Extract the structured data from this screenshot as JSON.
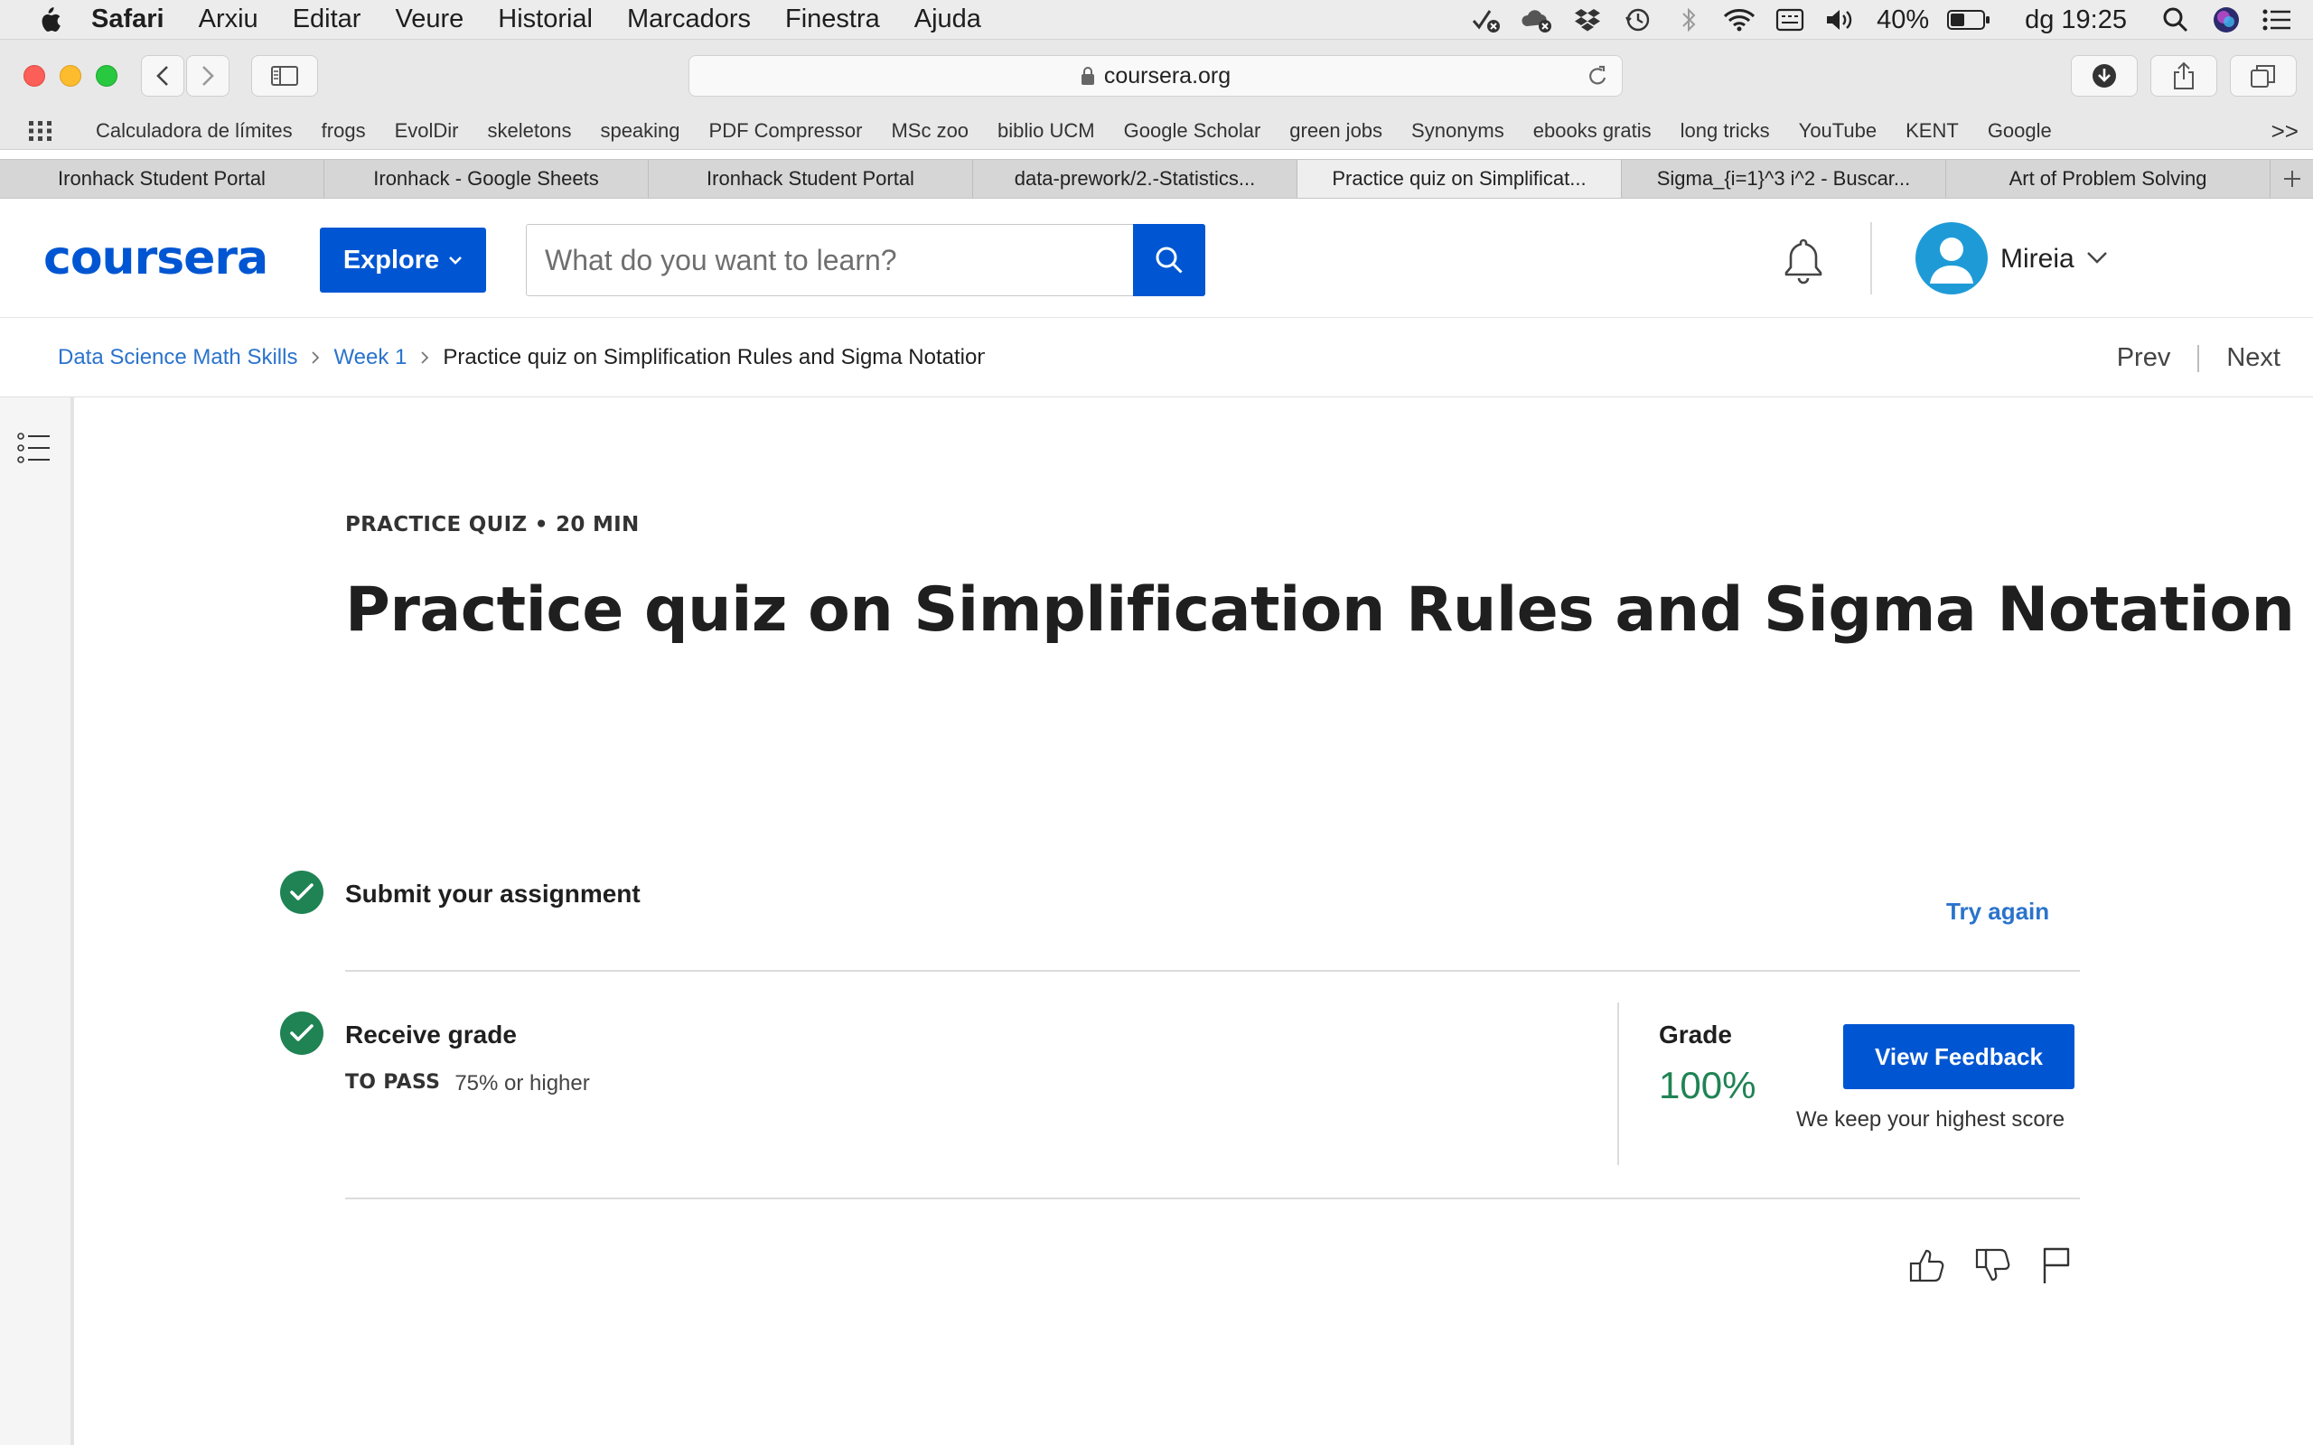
{
  "menubar": {
    "app_name": "Safari",
    "items": [
      "Arxiu",
      "Editar",
      "Veure",
      "Historial",
      "Marcadors",
      "Finestra",
      "Ajuda"
    ],
    "battery": "40%",
    "clock": "dg 19:25"
  },
  "browser": {
    "url": "coursera.org",
    "bookmarks": [
      "Calculadora de límites",
      "frogs",
      "EvolDir",
      "skeletons",
      "speaking",
      "PDF Compressor",
      "MSc zoo",
      "biblio UCM",
      "Google Scholar",
      "green jobs",
      "Synonyms",
      "ebooks gratis",
      "long tricks",
      "YouTube",
      "KENT",
      "Google"
    ],
    "bookmarks_more": ">>",
    "tabs": [
      {
        "label": "Ironhack Student Portal",
        "active": false
      },
      {
        "label": "Ironhack - Google Sheets",
        "active": false
      },
      {
        "label": "Ironhack Student Portal",
        "active": false
      },
      {
        "label": "data-prework/2.-Statistics...",
        "active": false
      },
      {
        "label": "Practice quiz on Simplificat...",
        "active": true
      },
      {
        "label": "Sigma_{i=1}^3 i^2 - Buscar...",
        "active": false
      },
      {
        "label": "Art of Problem Solving",
        "active": false
      }
    ]
  },
  "header": {
    "logo": "coursera",
    "explore_label": "Explore",
    "search_placeholder": "What do you want to learn?",
    "username": "Mireia"
  },
  "breadcrumb": {
    "course": "Data Science Math Skills",
    "week": "Week 1",
    "current": "Practice quiz on Simplification Rules and Sigma Notation"
  },
  "nav": {
    "prev_label": "Prev",
    "next_label": "Next"
  },
  "quiz": {
    "kicker": "PRACTICE QUIZ • 20 MIN",
    "title": "Practice quiz on Simplification Rules and Sigma Notation",
    "step1_label": "Submit your assignment",
    "try_again_label": "Try again",
    "step2_label": "Receive grade",
    "to_pass_label": "TO PASS",
    "to_pass_value": "75% or higher",
    "grade_label": "Grade",
    "grade_value": "100%",
    "view_feedback_label": "View Feedback",
    "highest_score_note": "We keep your highest score"
  },
  "colors": {
    "brand_blue": "#0056d2",
    "link_blue": "#2a73cc",
    "success_green": "#1f8354"
  },
  "icons": [
    "apple-icon",
    "search-icon",
    "bell-icon",
    "chevron-down-icon",
    "list-icon",
    "check-icon",
    "thumbs-up-icon",
    "thumbs-down-icon",
    "flag-icon"
  ]
}
